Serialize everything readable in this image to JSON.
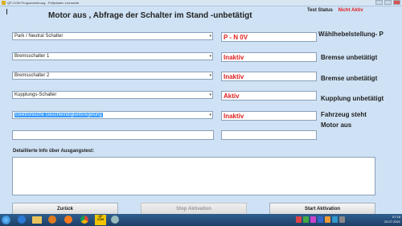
{
  "window": {
    "title": "QP-COM Programmierung - Prüfpfaden Lernwerte"
  },
  "header": {
    "title": "Motor aus , Abfrage der Schalter im Stand -unbetätigt",
    "test_status_label": "Test Status",
    "test_status_value": "Nicht Aktiv"
  },
  "rows": [
    {
      "select": "Park / Neutral Schalter",
      "status": "P - N  0V",
      "description": "Wählhebelstellung- P"
    },
    {
      "select": "Bremsschalter 1",
      "status": "Inaktiv",
      "description": "Bremse unbetätigt"
    },
    {
      "select": "Bremsschalter 2",
      "status": "Inaktiv",
      "description": "Bremse unbetätigt"
    },
    {
      "select": "Kupplungs-Schalter",
      "status": "Aktiv",
      "description": "Kupplung unbetätigt"
    },
    {
      "select": "Elektronische Geschwindigkeitsregelung",
      "status": "Inaktiv",
      "description": "Fahrzeug steht"
    }
  ],
  "extra_description": "Motor aus",
  "details": {
    "label": "Detaillierte Info über Ausgangstest:",
    "text": ""
  },
  "buttons": {
    "back": "Zurück",
    "stop": "Stop Aktivation",
    "start": "Start Aktivation"
  },
  "taskbar": {
    "apps": [
      "start-orb",
      "internet-explorer",
      "file-explorer",
      "media-player",
      "firefox",
      "chrome",
      "qp-com",
      "tool"
    ],
    "qp_label": "QP\nCOM",
    "time": "07:18",
    "date": "25.07.2021"
  },
  "colors": {
    "status_red": "#e02020",
    "window_bg": "#cfe2f5",
    "highlight": "#3399ff"
  }
}
